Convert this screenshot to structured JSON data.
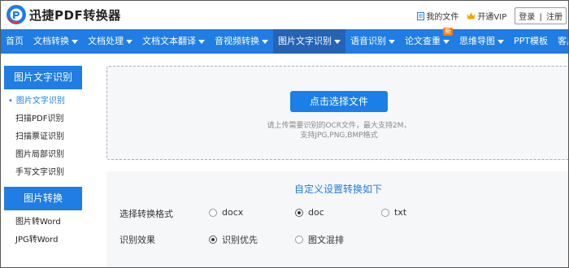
{
  "brand": {
    "name": "迅捷PDF转换器",
    "accent": "#1f7de4"
  },
  "top_links": {
    "my_files": "我的文件",
    "vip": "开通VIP",
    "login": "登录",
    "separator": "|",
    "register": "注册"
  },
  "nav": {
    "items": [
      {
        "label": "首页",
        "dropdown": false
      },
      {
        "label": "文档转换",
        "dropdown": true
      },
      {
        "label": "文档处理",
        "dropdown": true
      },
      {
        "label": "文档文本翻译",
        "dropdown": true
      },
      {
        "label": "音视频转换",
        "dropdown": true
      },
      {
        "label": "图片文字识别",
        "dropdown": true,
        "active": true
      },
      {
        "label": "语音识别",
        "dropdown": true
      },
      {
        "label": "论文查重",
        "dropdown": true,
        "badge": "新"
      },
      {
        "label": "思维导图",
        "dropdown": true
      },
      {
        "label": "PPT模板",
        "dropdown": false
      },
      {
        "label": "客户端",
        "dropdown": true
      }
    ]
  },
  "sidebar": {
    "section1_title": "图片文字识别",
    "section1_items": [
      "图片文字识别",
      "扫描PDF识别",
      "扫描票证识别",
      "图片局部识别",
      "手写文字识别"
    ],
    "section2_title": "图片转换",
    "section2_items": [
      "图片转Word",
      "JPG转Word"
    ]
  },
  "upload": {
    "button": "点击选择文件",
    "hint_line1": "请上传需要识别的OCR文件，最大支持2M，",
    "hint_line2": "支持JPG,PNG,BMP格式"
  },
  "settings": {
    "title": "自定义设置转换如下",
    "format_label": "选择转换格式",
    "format_options": [
      "docx",
      "doc",
      "txt"
    ],
    "format_selected": "doc",
    "effect_label": "识别效果",
    "effect_options": [
      "识别优先",
      "图文混排"
    ],
    "effect_selected": "识别优先"
  }
}
